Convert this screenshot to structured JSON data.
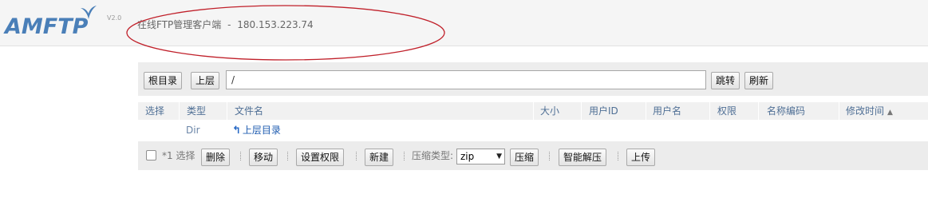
{
  "header": {
    "logo_text": "AMFTP",
    "version": "V2.0",
    "site_title": "在线FTP管理客户端",
    "separator": "-",
    "host": "180.153.223.74"
  },
  "pathbar": {
    "root_button": "根目录",
    "up_button": "上层",
    "path_value": "/",
    "go_button": "跳转",
    "refresh_button": "刷新"
  },
  "table": {
    "columns": [
      "选择",
      "类型",
      "文件名",
      "大小",
      "用户ID",
      "用户名",
      "权限",
      "名称编码",
      "修改时间"
    ],
    "rows": [
      {
        "type": "Dir",
        "name": "上层目录"
      }
    ]
  },
  "toolbar": {
    "select_label": "*1 选择",
    "delete_button": "删除",
    "move_button": "移动",
    "chmod_button": "设置权限",
    "new_button": "新建",
    "compress_type_label": "压缩类型:",
    "compress_type_value": "zip",
    "compress_button": "压缩",
    "smart_extract_button": "智能解压",
    "upload_button": "上传"
  },
  "colors": {
    "logo": "#4a7fb8",
    "header_link": "#4f6f95",
    "annotation": "#c0202a"
  },
  "icons": {
    "up_dir": "up-arrow-icon",
    "sort": "sort-ascending-icon",
    "select_arrow": "chevron-down-icon"
  }
}
